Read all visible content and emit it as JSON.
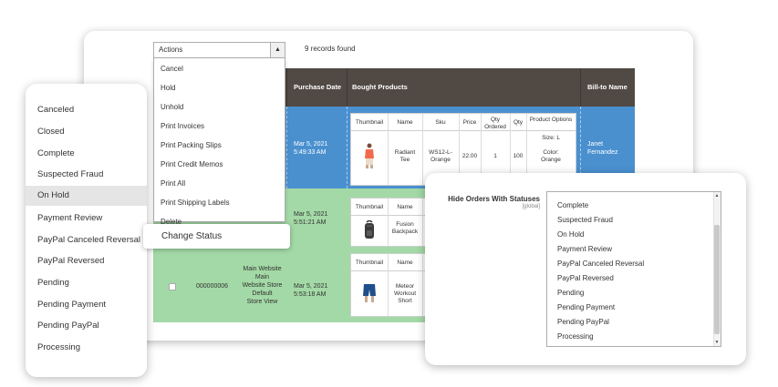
{
  "toolbar": {
    "actions_label": "Actions",
    "records_found": "9 records found"
  },
  "actions_menu": [
    "Cancel",
    "Hold",
    "Unhold",
    "Print Invoices",
    "Print Packing Slips",
    "Print Credit Memos",
    "Print All",
    "Print Shipping Labels",
    "Delete"
  ],
  "change_status_label": "Change Status",
  "grid": {
    "columns": [
      "Purchase Date",
      "Bought Products",
      "Bill-to Name"
    ],
    "inner_headers": [
      "Thumbnail",
      "Name",
      "Sku",
      "Price",
      "Qty Ordered",
      "Qty",
      "Product Options"
    ],
    "rows": [
      {
        "purchase_date": "Mar 5, 2021\n5:49:33 AM",
        "product_name": "Radiant\nTee",
        "sku": "WS12-L-\nOrange",
        "price": "22.00",
        "qty_ordered": "1",
        "qty": "100",
        "options": "Size: L\n\nColor:\nOrange",
        "bill_to": "Janet\nFernandez"
      },
      {
        "purchase_date": "Mar 5, 2021\n5:51:21 AM",
        "product_name": "Fusion\nBackpack"
      },
      {
        "order_id": "000000006",
        "store": "Main Website\nMain\nWebsite Store\nDefault\nStore View",
        "purchase_date": "Mar 5, 2021\n5:53:18 AM",
        "product_name": "Meteor\nWorkout\nShort"
      }
    ]
  },
  "status_filter": {
    "items": [
      "Canceled",
      "Closed",
      "Complete",
      "Suspected Fraud",
      "On Hold",
      "Payment Review",
      "PayPal Canceled Reversal",
      "PayPal Reversed",
      "Pending",
      "Pending Payment",
      "Pending PayPal",
      "Processing"
    ],
    "selected": "On Hold"
  },
  "config": {
    "label": "Hide Orders With Statuses",
    "scope": "[global]",
    "options": [
      "Complete",
      "Suspected Fraud",
      "On Hold",
      "Payment Review",
      "PayPal Canceled Reversal",
      "PayPal Reversed",
      "Pending",
      "Pending Payment",
      "Pending PayPal",
      "Processing"
    ]
  },
  "colors": {
    "header": "#514943",
    "selected_row": "#4a90cf",
    "highlight_row": "#a3d9a6"
  },
  "icons": {
    "select_caret": "▲",
    "scroll_up": "▲",
    "scroll_down": "▼"
  }
}
